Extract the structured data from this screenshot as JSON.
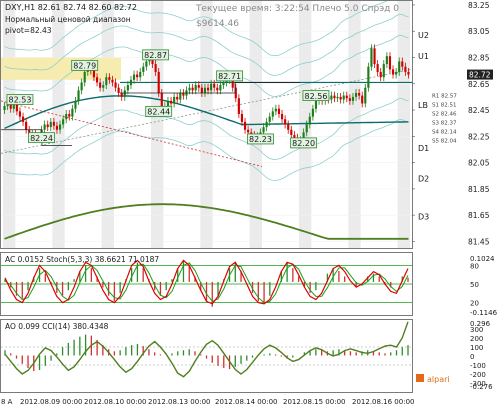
{
  "header": {
    "symbol_line": "DXY,H1  82.61 82.74 82.60 82.72",
    "subtitle_1": "Нормальный ценовой диапазон",
    "subtitle_2": "pivot=82.43",
    "time_line": "Текущее время: 3:22:54 Плечо 5.0 Спрэд 0",
    "balance": "$9614.46"
  },
  "colors": {
    "background": "#ffffff",
    "candle_up": "#1a7f1a",
    "candle_down": "#d40000",
    "pivot_line": "#0c6b6b",
    "ma_olive": "#4f7f1f",
    "band_line": "#8ecfcf",
    "zone_yellow": "#f7ecb0",
    "label_fill": "#e3f3e3",
    "label_border": "#2e8b2e",
    "ao_up": "#2e8b2e",
    "ao_down": "#d03030",
    "stoch_main": "#e00000",
    "stoch_signal": "#1a9f1a",
    "cci_line": "#4f7f1f"
  },
  "chart_data": [
    {
      "type": "candlestick",
      "title": "DXY,H1",
      "ylim": [
        81.4,
        83.28
      ],
      "y_ticks": [
        "83.25",
        "83.05",
        "82.85",
        "82.65",
        "82.45",
        "82.25",
        "82.05",
        "81.85",
        "81.65",
        "81.45"
      ],
      "level_labels": [
        "U2",
        "U1",
        "LB",
        "D1",
        "D2",
        "D3"
      ],
      "level_values": [
        83.02,
        82.86,
        82.49,
        82.16,
        81.93,
        81.64
      ],
      "price_tag": "82.72",
      "small_labels": [
        "R1 82.57",
        "S1 82.51",
        "S2 82.46",
        "S3 82.37",
        "S4 82.14",
        "S5 82.04"
      ],
      "peak_labels": [
        {
          "text": "82.53",
          "x": 5,
          "price": 82.53
        },
        {
          "text": "82.24",
          "x": 12,
          "price": 82.24
        },
        {
          "text": "82.79",
          "x": 26,
          "price": 82.79
        },
        {
          "text": "82.87",
          "x": 49,
          "price": 82.87
        },
        {
          "text": "82.44",
          "x": 50,
          "price": 82.44
        },
        {
          "text": "82.71",
          "x": 73,
          "price": 82.71
        },
        {
          "text": "82.23",
          "x": 83,
          "price": 82.23
        },
        {
          "text": "82.56",
          "x": 101,
          "price": 82.56
        },
        {
          "text": "82.20",
          "x": 97,
          "price": 82.2
        }
      ],
      "time_labels": [
        "2012.08.09 00:00",
        "2012.08.10 00:00",
        "2012.08.13 00:00",
        "2012.08.14 00:00",
        "2012.08.15 00:00",
        "2012.08.16 00:00"
      ],
      "close_prices": [
        82.48,
        82.5,
        82.46,
        82.52,
        82.44,
        82.4,
        82.36,
        82.3,
        82.26,
        82.27,
        82.25,
        82.24,
        82.3,
        82.34,
        82.32,
        82.36,
        82.33,
        82.3,
        82.34,
        82.38,
        82.42,
        82.4,
        82.46,
        82.52,
        82.6,
        82.66,
        82.74,
        82.78,
        82.75,
        82.7,
        82.66,
        82.62,
        82.64,
        82.7,
        82.68,
        82.66,
        82.62,
        82.58,
        82.55,
        82.6,
        82.64,
        82.68,
        82.72,
        82.7,
        82.74,
        82.78,
        82.82,
        82.85,
        82.8,
        82.74,
        82.58,
        82.46,
        82.48,
        82.52,
        82.5,
        82.55,
        82.53,
        82.58,
        82.56,
        82.6,
        82.62,
        82.6,
        82.64,
        82.62,
        82.58,
        82.62,
        82.6,
        82.65,
        82.62,
        82.6,
        82.64,
        82.66,
        82.68,
        82.7,
        82.62,
        82.54,
        82.42,
        82.36,
        82.3,
        82.28,
        82.26,
        82.24,
        82.25,
        82.28,
        82.32,
        82.36,
        82.4,
        82.44,
        82.46,
        82.42,
        82.38,
        82.34,
        82.3,
        82.26,
        82.24,
        82.22,
        82.22,
        82.28,
        82.34,
        82.4,
        82.46,
        82.52,
        82.54,
        82.52,
        82.55,
        82.53,
        82.56,
        82.54,
        82.55,
        82.53,
        82.56,
        82.54,
        82.52,
        82.55,
        82.58,
        82.56,
        82.5,
        82.62,
        82.78,
        82.92,
        82.8,
        82.74,
        82.7,
        82.8,
        82.86,
        82.76,
        82.72,
        82.74,
        82.82,
        82.78,
        82.74,
        82.72
      ]
    },
    {
      "type": "line",
      "title": "AC 0.0152  Stoch(5,3,3) 38.6621 71.0187",
      "ylim": [
        -0.12,
        0.105
      ],
      "y_ticks": [
        "0.1024",
        "80",
        "50",
        "20",
        "-0.1146"
      ],
      "series": [
        {
          "name": "Stoch main",
          "values": [
            60,
            40,
            25,
            20,
            35,
            60,
            80,
            70,
            50,
            30,
            20,
            25,
            45,
            70,
            85,
            80,
            60,
            40,
            25,
            20,
            30,
            55,
            80,
            88,
            78,
            55,
            35,
            25,
            30,
            50,
            75,
            88,
            80,
            60,
            40,
            22,
            18,
            30,
            55,
            78,
            85,
            70,
            50,
            30,
            20,
            18,
            25,
            45,
            70,
            85,
            82,
            65,
            45,
            30,
            25,
            35,
            55,
            75,
            80,
            70,
            55,
            45,
            50,
            60,
            70,
            65,
            50,
            38,
            35,
            55,
            75
          ]
        },
        {
          "name": "Stoch signal",
          "values": [
            55,
            48,
            35,
            25,
            28,
            45,
            65,
            72,
            62,
            45,
            30,
            24,
            32,
            52,
            72,
            80,
            72,
            55,
            38,
            28,
            26,
            40,
            62,
            80,
            82,
            68,
            48,
            32,
            28,
            38,
            60,
            80,
            84,
            72,
            52,
            34,
            22,
            26,
            42,
            64,
            80,
            78,
            60,
            42,
            28,
            20,
            22,
            34,
            56,
            76,
            82,
            74,
            55,
            40,
            30,
            30,
            44,
            62,
            76,
            76,
            64,
            52,
            48,
            54,
            64,
            66,
            58,
            46,
            38,
            46,
            64
          ]
        },
        {
          "name": "AC",
          "values": [
            0.01,
            -0.02,
            -0.05,
            -0.06,
            -0.03,
            0.02,
            0.05,
            0.03,
            -0.01,
            -0.04,
            -0.05,
            -0.03,
            0.01,
            0.04,
            0.06,
            0.05,
            0.02,
            -0.02,
            -0.05,
            -0.07,
            -0.04,
            0.01,
            0.05,
            0.07,
            0.05,
            0.01,
            -0.03,
            -0.05,
            -0.03,
            0.01,
            0.05,
            0.08,
            0.06,
            0.02,
            -0.03,
            -0.07,
            -0.09,
            -0.05,
            0.01,
            0.05,
            0.07,
            0.04,
            0,
            -0.04,
            -0.07,
            -0.08,
            -0.05,
            0,
            0.04,
            0.07,
            0.05,
            0.02,
            -0.02,
            -0.04,
            -0.03,
            0,
            0.03,
            0.05,
            0.04,
            0.02,
            0,
            -0.02,
            0,
            0.02,
            0.03,
            0.02,
            -0.01,
            -0.02,
            0,
            0.02,
            0.015
          ]
        }
      ]
    },
    {
      "type": "line",
      "title": "AO 0.099  CCI(14) 380.4348",
      "ylim": [
        -0.35,
        0.34
      ],
      "y_ticks": [
        "0.296",
        "300",
        "200",
        "100",
        "0",
        "-100",
        "-200",
        "-300",
        "-0.276"
      ],
      "series": [
        {
          "name": "AO",
          "values": [
            0.05,
            0.02,
            -0.03,
            -0.08,
            -0.12,
            -0.15,
            -0.14,
            -0.1,
            -0.05,
            0.02,
            0.08,
            0.12,
            0.15,
            0.18,
            0.2,
            0.19,
            0.15,
            0.1,
            0.06,
            0.04,
            0.05,
            0.08,
            0.1,
            0.11,
            0.09,
            0.06,
            0.03,
            0.01,
            0,
            0.02,
            0.04,
            0.05,
            0.06,
            0.04,
            0.01,
            -0.03,
            -0.07,
            -0.1,
            -0.12,
            -0.13,
            -0.11,
            -0.08,
            -0.05,
            -0.02,
            0,
            0.01,
            0.02,
            0.01,
            -0.01,
            -0.03,
            -0.02,
            0,
            0.03,
            0.05,
            0.06,
            0.05,
            0.04,
            0.05,
            0.06,
            0.05,
            0.04,
            0.03,
            0.04,
            0.05,
            0.04,
            0.03,
            0.02,
            0.03,
            0.05,
            0.08,
            0.099
          ]
        },
        {
          "name": "CCI",
          "values": [
            20,
            -60,
            -140,
            -200,
            -160,
            -80,
            20,
            90,
            60,
            -10,
            -90,
            -160,
            -120,
            -40,
            50,
            120,
            160,
            110,
            40,
            -40,
            -120,
            -180,
            -140,
            -60,
            30,
            110,
            160,
            100,
            20,
            -80,
            -190,
            -230,
            -170,
            -60,
            40,
            130,
            170,
            120,
            30,
            -60,
            -150,
            -200,
            -150,
            -70,
            10,
            80,
            120,
            90,
            40,
            -20,
            -60,
            -40,
            10,
            60,
            90,
            70,
            30,
            0,
            20,
            60,
            80,
            60,
            40,
            30,
            50,
            80,
            110,
            120,
            100,
            200,
            380
          ]
        }
      ]
    }
  ],
  "footer": {
    "axis_start_label": "8 A",
    "watermark": "alpari"
  }
}
